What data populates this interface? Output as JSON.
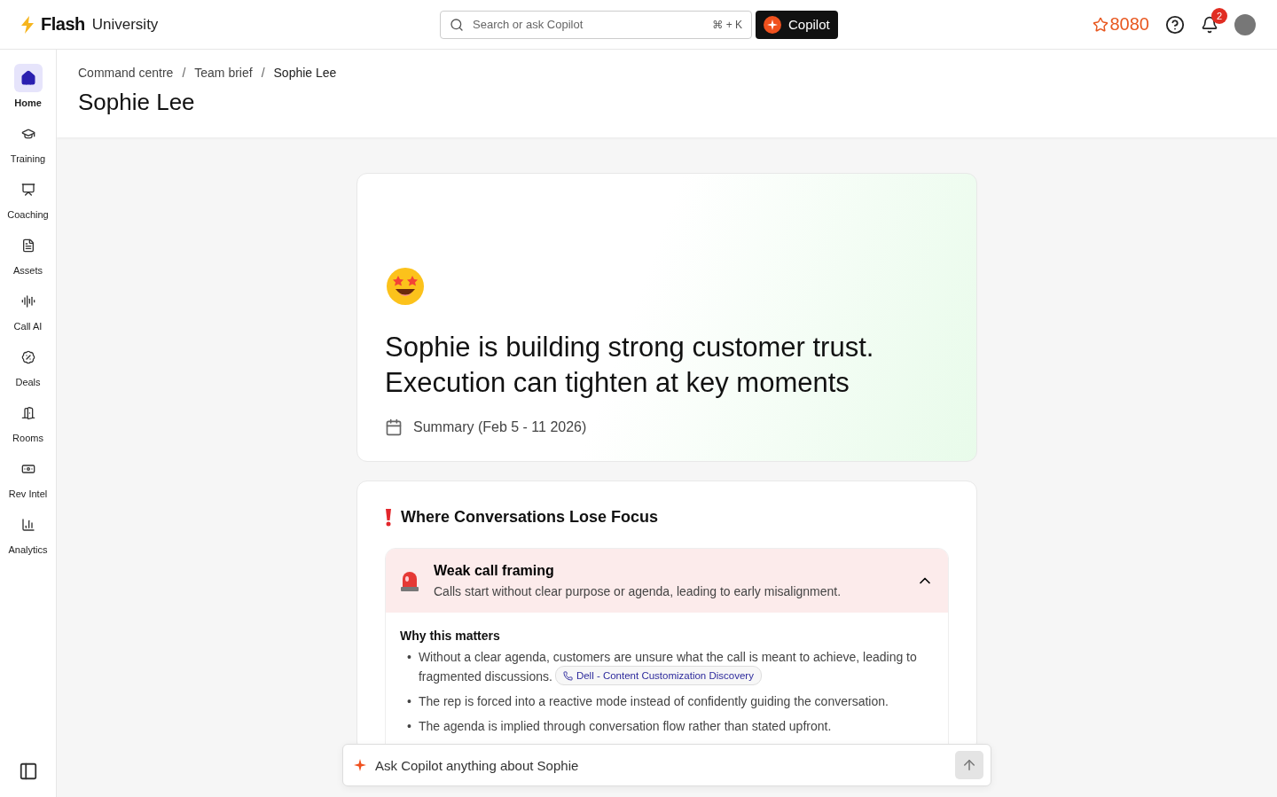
{
  "brand": {
    "logo": "Flash",
    "product": "University"
  },
  "search": {
    "placeholder": "Search or ask Copilot",
    "shortcut": "⌘ + K"
  },
  "copilot_button": "Copilot",
  "points": "8080",
  "notifications": {
    "count": "2"
  },
  "sidebar": {
    "items": [
      {
        "label": "Home",
        "selected": true
      },
      {
        "label": "Training",
        "selected": false
      },
      {
        "label": "Coaching",
        "selected": false
      },
      {
        "label": "Assets",
        "selected": false
      },
      {
        "label": "Call AI",
        "selected": false
      },
      {
        "label": "Deals",
        "selected": false
      },
      {
        "label": "Rooms",
        "selected": false
      },
      {
        "label": "Rev Intel",
        "selected": false
      },
      {
        "label": "Analytics",
        "selected": false
      }
    ]
  },
  "breadcrumbs": [
    {
      "label": "Command centre"
    },
    {
      "separator": "/",
      "label": "Team brief"
    },
    {
      "separator": "/",
      "label": "Sophie Lee"
    }
  ],
  "page_title": "Sophie Lee",
  "summary_card": {
    "headline": "Sophie is building strong customer trust. Execution can tighten at key moments",
    "period": "Summary (Feb 5 - 11 2026)"
  },
  "focus_section": {
    "title": "Where Conversations Lose Focus",
    "items": [
      {
        "title": "Weak call framing",
        "description": "Calls start without clear purpose or agenda, leading to early misalignment.",
        "expanded": true,
        "why_title": "Why this matters",
        "bullets": [
          {
            "marker": "•",
            "text": "Without a clear agenda, customers are unsure what the call is meant to achieve, leading to fragmented discussions.",
            "call_tag": "Dell - Content Customization Discovery"
          },
          {
            "marker": "•",
            "text": "The rep is forced into a reactive mode instead of confidently guiding the conversation."
          },
          {
            "marker": "•",
            "text": "The agenda is implied through conversation flow rather than stated upfront."
          }
        ]
      }
    ]
  },
  "composer": {
    "placeholder": "Ask Copilot anything about Sophie"
  }
}
